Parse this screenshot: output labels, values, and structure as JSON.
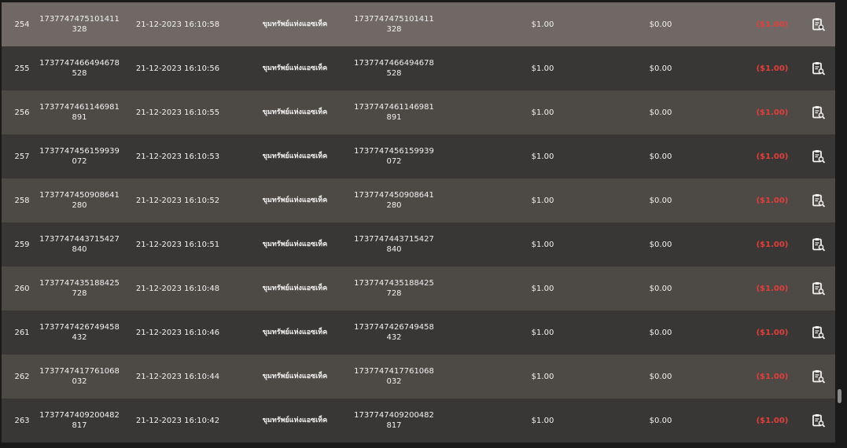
{
  "rows": [
    {
      "no": "254",
      "id": "1737747475101411328",
      "date": "21-12-2023 16:10:58",
      "name": "ขุมทรัพย์แห่งแอซเท็ค",
      "ref": "1737747475101411328",
      "bet": "$1.00",
      "win": "$0.00",
      "net": "($1.00)"
    },
    {
      "no": "255",
      "id": "1737747466494678528",
      "date": "21-12-2023 16:10:56",
      "name": "ขุมทรัพย์แห่งแอซเท็ค",
      "ref": "1737747466494678528",
      "bet": "$1.00",
      "win": "$0.00",
      "net": "($1.00)"
    },
    {
      "no": "256",
      "id": "1737747461146981891",
      "date": "21-12-2023 16:10:55",
      "name": "ขุมทรัพย์แห่งแอซเท็ค",
      "ref": "1737747461146981891",
      "bet": "$1.00",
      "win": "$0.00",
      "net": "($1.00)"
    },
    {
      "no": "257",
      "id": "1737747456159939072",
      "date": "21-12-2023 16:10:53",
      "name": "ขุมทรัพย์แห่งแอซเท็ค",
      "ref": "1737747456159939072",
      "bet": "$1.00",
      "win": "$0.00",
      "net": "($1.00)"
    },
    {
      "no": "258",
      "id": "1737747450908641280",
      "date": "21-12-2023 16:10:52",
      "name": "ขุมทรัพย์แห่งแอซเท็ค",
      "ref": "1737747450908641280",
      "bet": "$1.00",
      "win": "$0.00",
      "net": "($1.00)"
    },
    {
      "no": "259",
      "id": "1737747443715427840",
      "date": "21-12-2023 16:10:51",
      "name": "ขุมทรัพย์แห่งแอซเท็ค",
      "ref": "1737747443715427840",
      "bet": "$1.00",
      "win": "$0.00",
      "net": "($1.00)"
    },
    {
      "no": "260",
      "id": "1737747435188425728",
      "date": "21-12-2023 16:10:48",
      "name": "ขุมทรัพย์แห่งแอซเท็ค",
      "ref": "1737747435188425728",
      "bet": "$1.00",
      "win": "$0.00",
      "net": "($1.00)"
    },
    {
      "no": "261",
      "id": "1737747426749458432",
      "date": "21-12-2023 16:10:46",
      "name": "ขุมทรัพย์แห่งแอซเท็ค",
      "ref": "1737747426749458432",
      "bet": "$1.00",
      "win": "$0.00",
      "net": "($1.00)"
    },
    {
      "no": "262",
      "id": "1737747417761068032",
      "date": "21-12-2023 16:10:44",
      "name": "ขุมทรัพย์แห่งแอซเท็ค",
      "ref": "1737747417761068032",
      "bet": "$1.00",
      "win": "$0.00",
      "net": "($1.00)"
    },
    {
      "no": "263",
      "id": "1737747409200482817",
      "date": "21-12-2023 16:10:42",
      "name": "ขุมทรัพย์แห่งแอซเท็ค",
      "ref": "1737747409200482817",
      "bet": "$1.00",
      "win": "$0.00",
      "net": "($1.00)"
    }
  ],
  "action_icon": "clipboard-search-icon",
  "colors": {
    "row_light": "#4d4945",
    "row_dark": "#393735",
    "row_hover": "#6f6864",
    "negative": "#e0403c",
    "text": "#f2f2f2"
  }
}
